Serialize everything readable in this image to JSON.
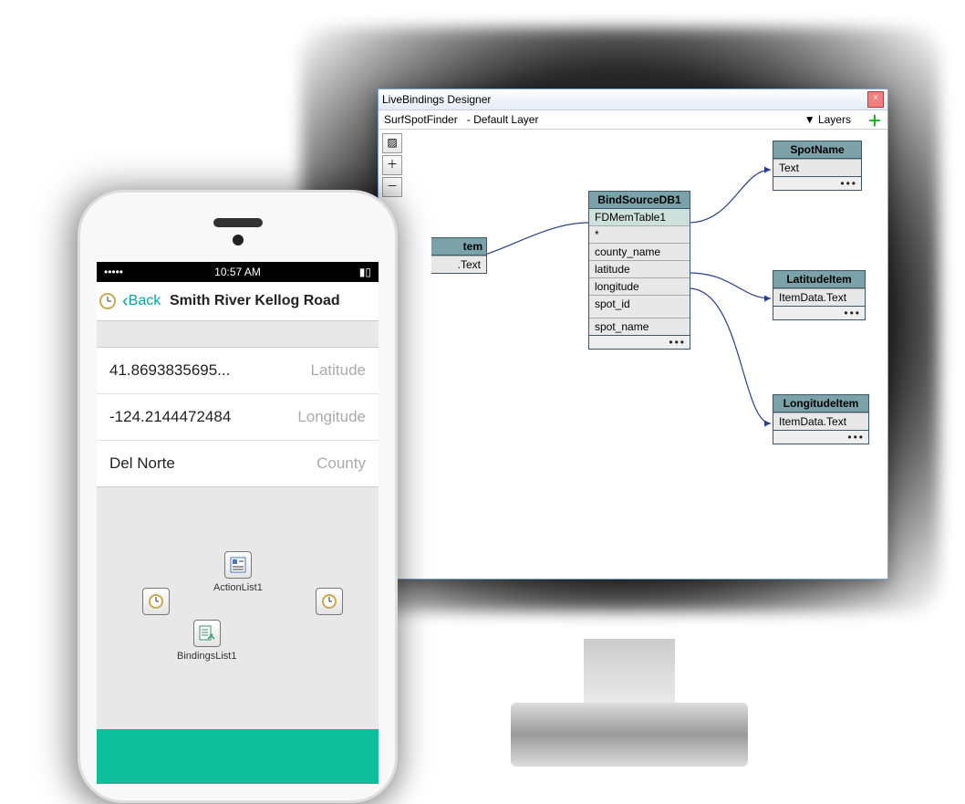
{
  "phone": {
    "statusbar_time": "10:57 AM",
    "back_label": "Back",
    "title": "Smith River Kellog Road",
    "rows": [
      {
        "value": "41.8693835695...",
        "label": "Latitude"
      },
      {
        "value": "-124.2144472484",
        "label": "Longitude"
      },
      {
        "value": "Del Norte",
        "label": "County"
      }
    ],
    "components": {
      "actionlist": "ActionList1",
      "bindingslist": "BindingsList1"
    }
  },
  "designer": {
    "window_title": "LiveBindings Designer",
    "context": "SurfSpotFinder",
    "layer": "- Default Layer",
    "layers_label": "Layers",
    "nodes": {
      "bindsource": {
        "title": "BindSourceDB1",
        "rows": [
          "FDMemTable1",
          "*",
          "county_name",
          "latitude",
          "longitude",
          "spot_id",
          "spot_name"
        ]
      },
      "spotname": {
        "title": "SpotName",
        "row": "Text"
      },
      "latitude": {
        "title": "LatitudeItem",
        "row": "ItemData.Text"
      },
      "longitude": {
        "title": "LongitudeItem",
        "row": "ItemData.Text"
      },
      "partial": {
        "title_suffix": "tem",
        "row": ".Text"
      }
    }
  }
}
